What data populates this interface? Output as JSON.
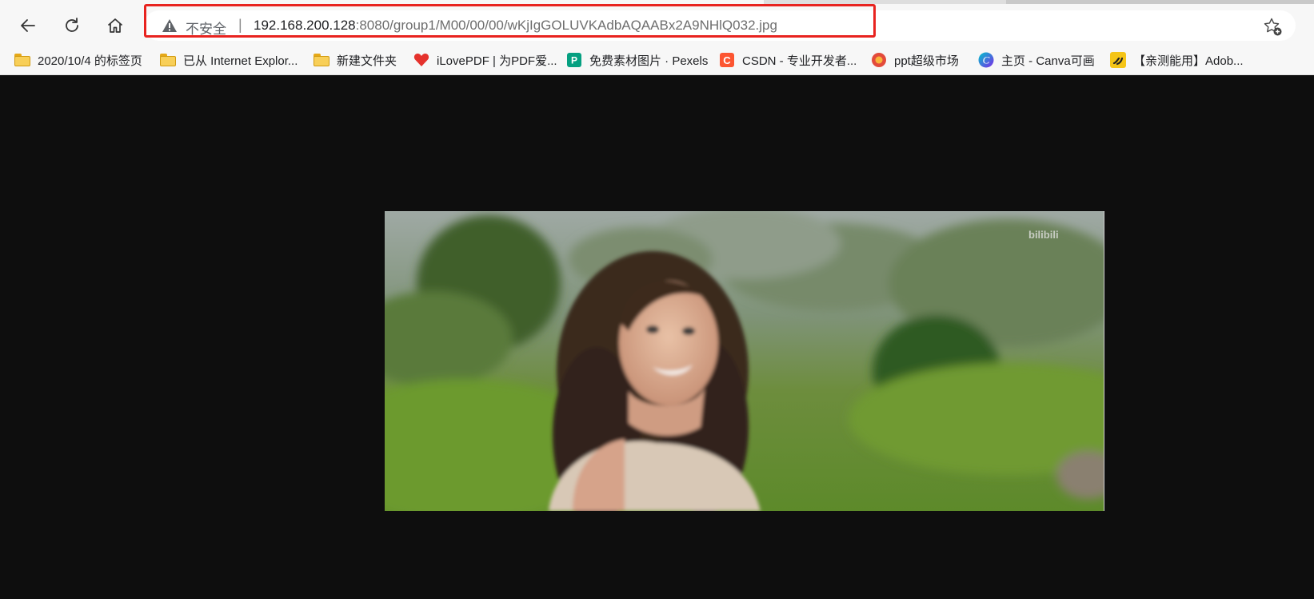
{
  "address_bar": {
    "security_label": "不安全",
    "separator": "|",
    "url_host": "192.168.200.128",
    "url_rest": ":8080/group1/M00/00/00/wKjIgGOLUVKAdbAQAABx2A9NHlQ032.jpg"
  },
  "bookmarks": [
    {
      "label": "2020/10/4 的标签页",
      "icon": "folder-icon"
    },
    {
      "label": "已从 Internet Explor...",
      "icon": "folder-icon"
    },
    {
      "label": "新建文件夹",
      "icon": "folder-icon"
    },
    {
      "label": "iLovePDF | 为PDF爱...",
      "icon": "ilovepdf-icon"
    },
    {
      "label": "免费素材图片 · Pexels",
      "icon": "pexels-icon"
    },
    {
      "label": "CSDN - 专业开发者...",
      "icon": "csdn-icon"
    },
    {
      "label": "ppt超级市场",
      "icon": "ppt-market-icon"
    },
    {
      "label": "主页 - Canva可画",
      "icon": "canva-icon"
    },
    {
      "label": "【亲测能用】Adob...",
      "icon": "adobe-share-icon"
    }
  ],
  "image": {
    "watermark": "bilibili"
  },
  "colors": {
    "highlight": "#e8231f",
    "viewer_background": "#0e0e0e"
  }
}
